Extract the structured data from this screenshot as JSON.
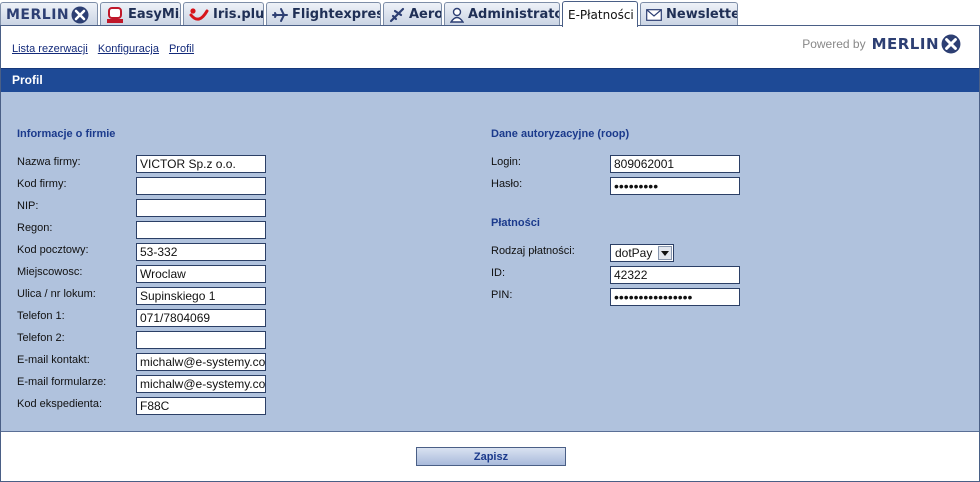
{
  "tabs": [
    {
      "label": "",
      "icon": "merlin-logo"
    },
    {
      "label": "EasyMix",
      "icon": "easymix-logo"
    },
    {
      "label": "Iris.plus",
      "icon": "tui-smile-logo"
    },
    {
      "label": "Flightexpress",
      "icon": "plane-icon"
    },
    {
      "label": "Aero",
      "icon": "plane-icon"
    },
    {
      "label": "Administrator",
      "icon": "user-icon"
    },
    {
      "label": "E-Płatności",
      "icon": ""
    },
    {
      "label": "Newsletter",
      "icon": "envelope-icon"
    }
  ],
  "merlin_text": "MERLIN",
  "subnav": [
    "Lista rezerwacji",
    "Konfiguracja",
    "Profil"
  ],
  "powered_by": "Powered by",
  "section_title": "Profil",
  "company": {
    "title": "Informacje o firmie",
    "fields": [
      {
        "label": "Nazwa firmy:",
        "value": "VICTOR Sp.z o.o."
      },
      {
        "label": "Kod firmy:",
        "value": ""
      },
      {
        "label": "NIP:",
        "value": ""
      },
      {
        "label": "Regon:",
        "value": ""
      },
      {
        "label": "Kod pocztowy:",
        "value": "53-332"
      },
      {
        "label": "Miejscowosc:",
        "value": "Wroclaw"
      },
      {
        "label": "Ulica / nr lokum:",
        "value": "Supinskiego 1"
      },
      {
        "label": "Telefon 1:",
        "value": "071/7804069"
      },
      {
        "label": "Telefon 2:",
        "value": ""
      },
      {
        "label": "E-mail kontakt:",
        "value": "michalw@e-systemy.com"
      },
      {
        "label": "E-mail formularze:",
        "value": "michalw@e-systemy.com"
      },
      {
        "label": "Kod ekspedienta:",
        "value": "F88C"
      }
    ]
  },
  "auth": {
    "title": "Dane autoryzacyjne (roop)",
    "login_label": "Login:",
    "login_value": "809062001",
    "password_label": "Hasło:",
    "password_value": "•••••••••"
  },
  "payments": {
    "title": "Płatności",
    "type_label": "Rodzaj płatności:",
    "type_value": "dotPay",
    "id_label": "ID:",
    "id_value": "42322",
    "pin_label": "PIN:",
    "pin_value": "••••••••••••••••"
  },
  "save_label": "Zapisz",
  "colors": {
    "brand": "#1e4a96",
    "panel": "#b0c2dd",
    "heading": "#1b3a8c"
  }
}
